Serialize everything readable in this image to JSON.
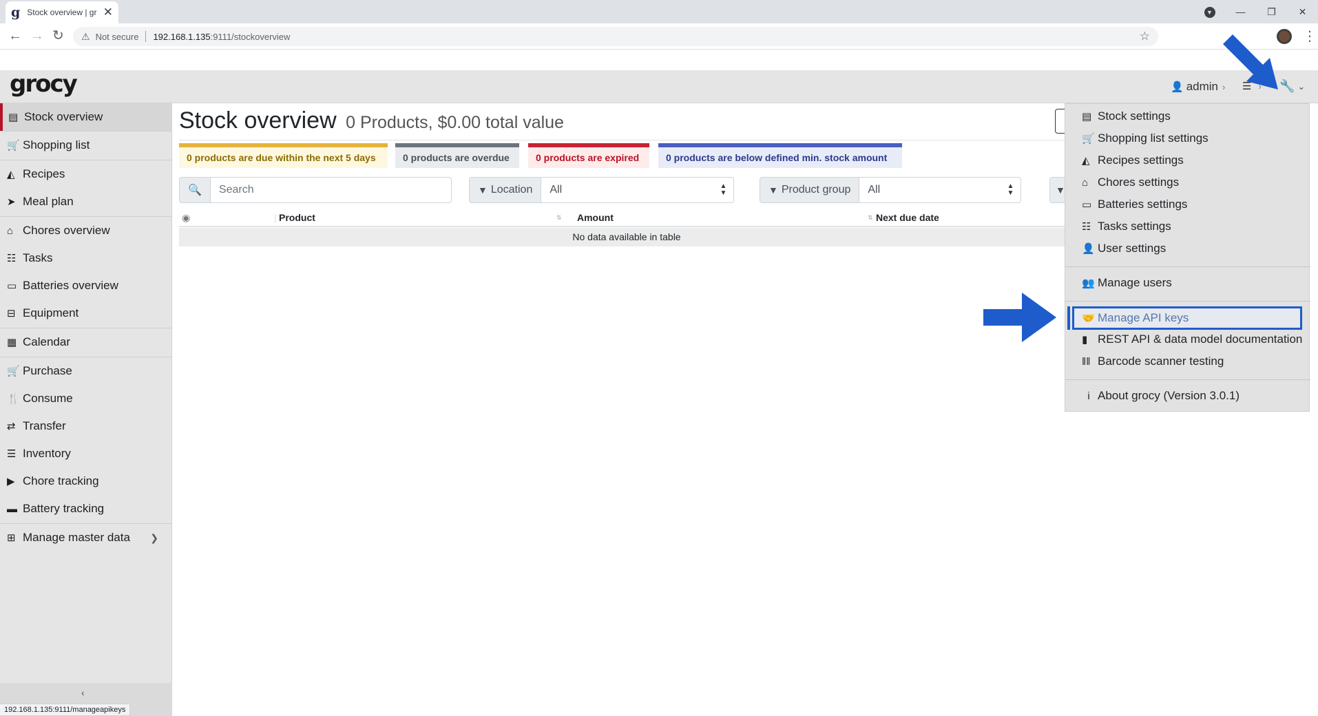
{
  "browser": {
    "tab_title": "Stock overview | gr",
    "url_warning": "Not secure",
    "url_host": "192.168.1.135",
    "url_path": ":9111/stockoverview",
    "status_url": "192.168.1.135:9111/manageapikeys"
  },
  "app": {
    "logo": "grocy",
    "user": "admin"
  },
  "sidebar": {
    "items": [
      {
        "label": "Stock overview",
        "icon": "box-icon"
      },
      {
        "label": "Shopping list",
        "icon": "cart-icon"
      },
      {
        "label": "Recipes",
        "icon": "pizza-icon"
      },
      {
        "label": "Meal plan",
        "icon": "paper-plane-icon"
      },
      {
        "label": "Chores overview",
        "icon": "home-icon"
      },
      {
        "label": "Tasks",
        "icon": "tasks-icon"
      },
      {
        "label": "Batteries overview",
        "icon": "battery-icon"
      },
      {
        "label": "Equipment",
        "icon": "toolbox-icon"
      },
      {
        "label": "Calendar",
        "icon": "calendar-icon"
      },
      {
        "label": "Purchase",
        "icon": "cart-plus-icon"
      },
      {
        "label": "Consume",
        "icon": "utensils-icon"
      },
      {
        "label": "Transfer",
        "icon": "exchange-icon"
      },
      {
        "label": "Inventory",
        "icon": "list-icon"
      },
      {
        "label": "Chore tracking",
        "icon": "play-icon"
      },
      {
        "label": "Battery tracking",
        "icon": "car-battery-icon"
      },
      {
        "label": "Manage master data",
        "icon": "table-icon"
      }
    ]
  },
  "main": {
    "title": "Stock overview",
    "subtitle": "0 Products, $0.00 total value",
    "badges": {
      "due": "0 products are due within the next 5 days",
      "overdue": "0 products are overdue",
      "expired": "0 products are expired",
      "below": "0 products are below defined min. stock amount"
    },
    "search_placeholder": "Search",
    "filters": {
      "location_label": "Location",
      "location_value": "All",
      "product_group_label": "Product group",
      "product_group_value": "All"
    },
    "table": {
      "columns": [
        "Product",
        "Amount",
        "Next due date"
      ],
      "empty": "No data available in table"
    }
  },
  "settings_menu": {
    "items": [
      {
        "label": "Stock settings"
      },
      {
        "label": "Shopping list settings"
      },
      {
        "label": "Recipes settings"
      },
      {
        "label": "Chores settings"
      },
      {
        "label": "Batteries settings"
      },
      {
        "label": "Tasks settings"
      },
      {
        "label": "User settings"
      },
      {
        "label": "Manage users"
      },
      {
        "label": "Manage API keys"
      },
      {
        "label": "REST API & data model documentation"
      },
      {
        "label": "Barcode scanner testing"
      },
      {
        "label": "About grocy (Version 3.0.1)"
      }
    ]
  },
  "colors": {
    "accent_red": "#b8112a",
    "annotation_blue": "#1e5ccc"
  }
}
